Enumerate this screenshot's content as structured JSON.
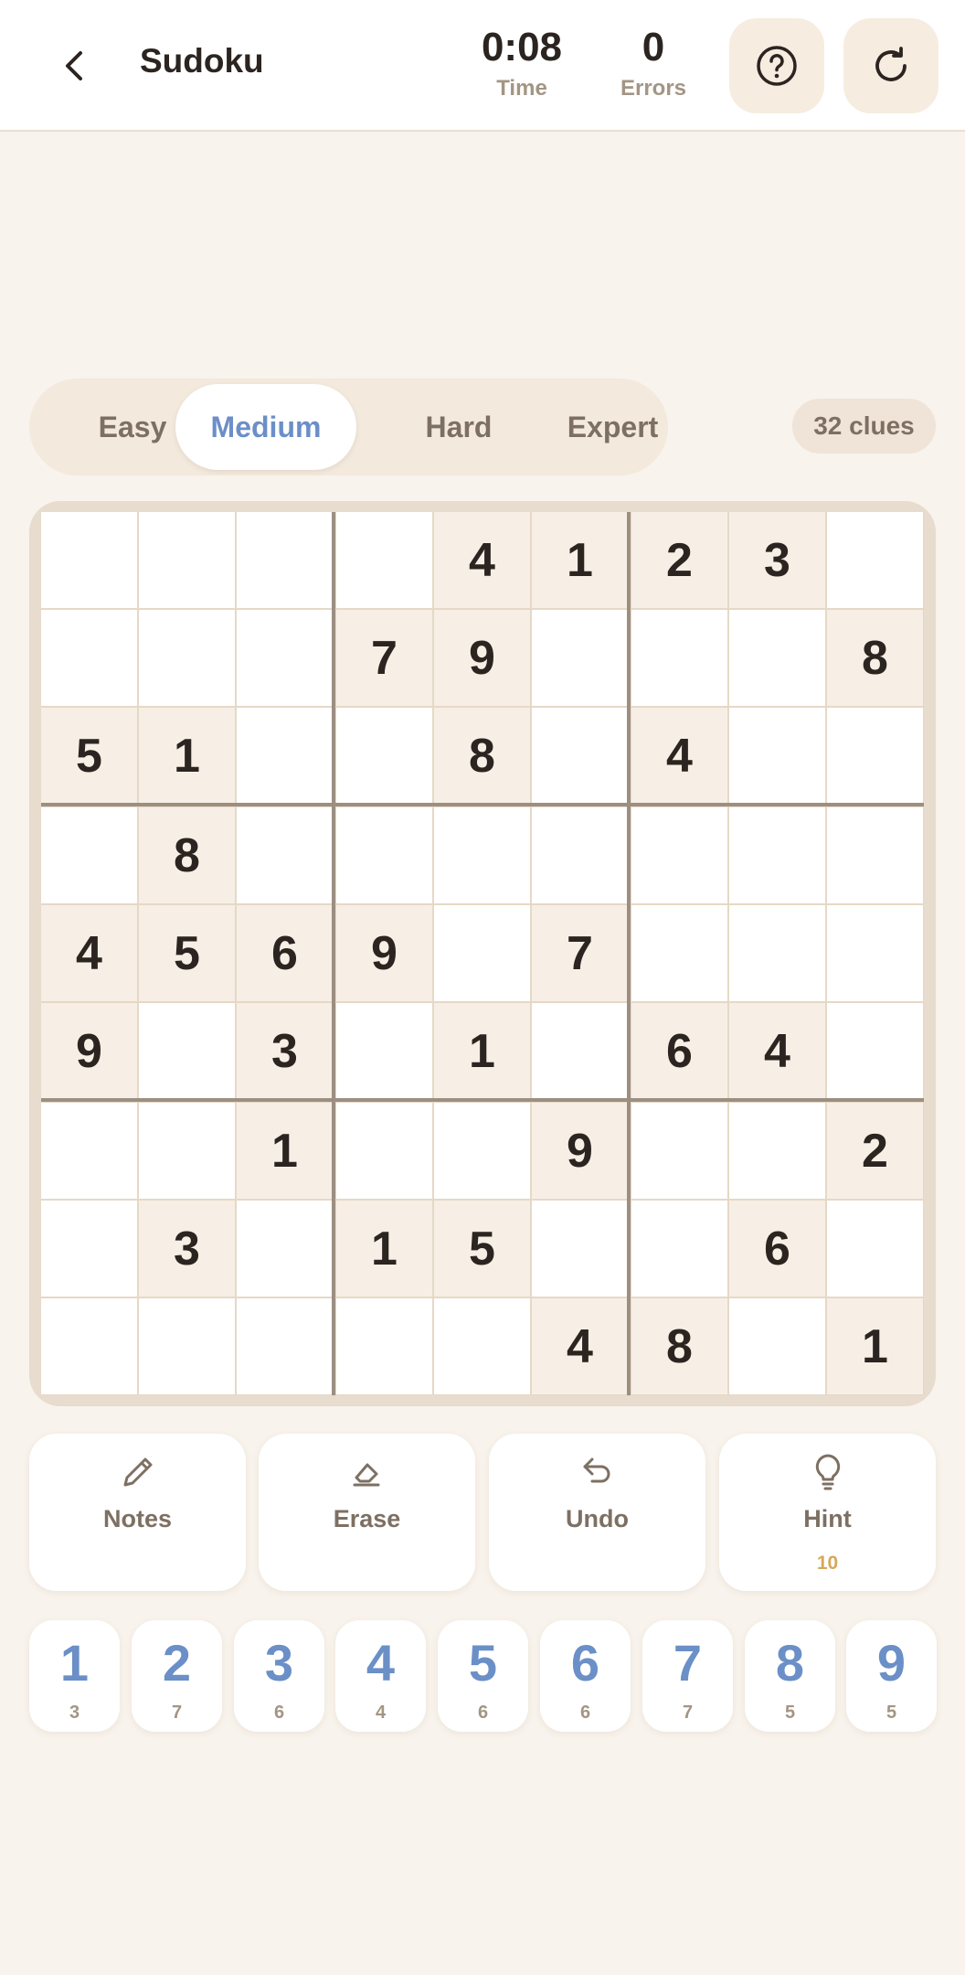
{
  "header": {
    "title": "Sudoku",
    "time": "0:08",
    "time_label": "Time",
    "errors": "0",
    "errors_label": "Errors"
  },
  "difficulty": {
    "tabs": [
      "Easy",
      "Medium",
      "Hard",
      "Expert"
    ],
    "selected": "Medium",
    "clues": "32 clues"
  },
  "board": {
    "rows": [
      [
        "",
        "",
        "",
        "",
        "4",
        "1",
        "2",
        "3",
        ""
      ],
      [
        "",
        "",
        "",
        "7",
        "9",
        "",
        "",
        "",
        "8"
      ],
      [
        "5",
        "1",
        "",
        "",
        "8",
        "",
        "4",
        "",
        ""
      ],
      [
        "",
        "8",
        "",
        "",
        "",
        "",
        "",
        "",
        ""
      ],
      [
        "4",
        "5",
        "6",
        "9",
        "",
        "7",
        "",
        "",
        ""
      ],
      [
        "9",
        "",
        "3",
        "",
        "1",
        "",
        "6",
        "4",
        ""
      ],
      [
        "",
        "",
        "1",
        "",
        "",
        "9",
        "",
        "",
        "2"
      ],
      [
        "",
        "3",
        "",
        "1",
        "5",
        "",
        "",
        "6",
        ""
      ],
      [
        "",
        "",
        "",
        "",
        "",
        "4",
        "8",
        "",
        "1"
      ]
    ]
  },
  "actions": {
    "notes": "Notes",
    "erase": "Erase",
    "undo": "Undo",
    "hint": "Hint",
    "hint_count": "10"
  },
  "numpad": [
    {
      "digit": "1",
      "count": "3"
    },
    {
      "digit": "2",
      "count": "7"
    },
    {
      "digit": "3",
      "count": "6"
    },
    {
      "digit": "4",
      "count": "4"
    },
    {
      "digit": "5",
      "count": "6"
    },
    {
      "digit": "6",
      "count": "6"
    },
    {
      "digit": "7",
      "count": "7"
    },
    {
      "digit": "8",
      "count": "5"
    },
    {
      "digit": "9",
      "count": "5"
    }
  ],
  "colors": {
    "accent": "#6b8fc7",
    "background": "#f8f3ec",
    "given_cell": "#f7efe5",
    "hint_count": "#d6a85a"
  },
  "icons": {
    "back": "chevron-left-icon",
    "help": "question-circle-icon",
    "restart": "refresh-icon",
    "notes": "pencil-icon",
    "erase": "eraser-icon",
    "undo": "undo-arrow-icon",
    "hint": "lightbulb-icon"
  }
}
